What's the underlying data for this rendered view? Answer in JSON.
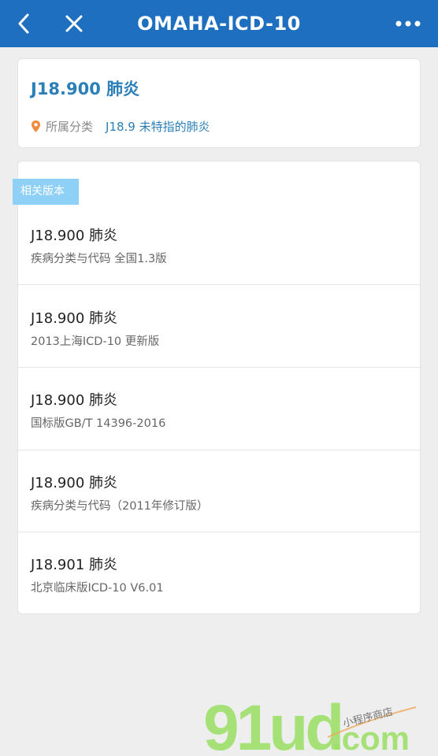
{
  "nav": {
    "title": "OMAHA-ICD-10",
    "back_icon": "back-chevron-icon",
    "close_icon": "close-icon",
    "more_icon": "more-dots-icon",
    "bg_color": "#1f6fc0"
  },
  "entry": {
    "code_title": "J18.900 肺炎",
    "category_label": "所属分类",
    "category_value": "J18.9 未特指的肺炎",
    "location_icon": "location-pin-icon",
    "accent_color": "#2b7fb9"
  },
  "versions": {
    "section_label": "相关版本",
    "items": [
      {
        "title": "J18.900 肺炎",
        "subtitle": "疾病分类与代码 全国1.3版"
      },
      {
        "title": "J18.900 肺炎",
        "subtitle": "2013上海ICD-10 更新版"
      },
      {
        "title": "J18.900 肺炎",
        "subtitle": "国标版GB/T 14396-2016"
      },
      {
        "title": "J18.900 肺炎",
        "subtitle": "疾病分类与代码（2011年修订版）"
      },
      {
        "title": "J18.901 肺炎",
        "subtitle": "北京临床版ICD-10 V6.01"
      }
    ]
  },
  "watermark": {
    "logo_text": "91ud.com",
    "tagline": "小程序商店"
  }
}
